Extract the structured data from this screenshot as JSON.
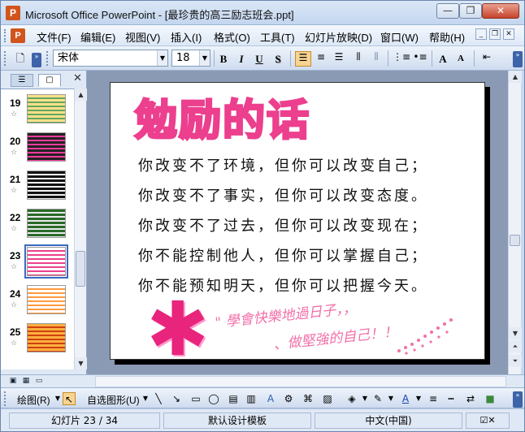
{
  "window": {
    "title": "Microsoft Office PowerPoint - [最珍贵的高三励志班会.ppt]",
    "app_icon_letter": "P",
    "minimize": "—",
    "restore": "❐",
    "close": "✕"
  },
  "menubar": {
    "items": [
      "文件(F)",
      "编辑(E)",
      "视图(V)",
      "插入(I)",
      "格式(O)",
      "工具(T)",
      "幻灯片放映(D)",
      "窗口(W)",
      "帮助(H)"
    ],
    "mdi_minimize": "_",
    "mdi_restore": "❐",
    "mdi_close": "✕"
  },
  "toolbar": {
    "font_name": "宋体",
    "font_size": "18",
    "bold": "B",
    "italic": "I",
    "underline": "U",
    "shadow": "S",
    "increase_font": "A",
    "decrease_font": "A"
  },
  "slides_panel": {
    "thumbnails": [
      {
        "number": "19",
        "colors": [
          "#fde08a",
          "#60a860"
        ]
      },
      {
        "number": "20",
        "colors": [
          "#222222",
          "#ff3aa0"
        ]
      },
      {
        "number": "21",
        "colors": [
          "#111111",
          "#f0f0f0"
        ]
      },
      {
        "number": "22",
        "colors": [
          "#2a6a2a",
          "#eaeaea"
        ]
      },
      {
        "number": "23",
        "colors": [
          "#ffffff",
          "#ec3f8e"
        ],
        "selected": true
      },
      {
        "number": "24",
        "colors": [
          "#ffffff",
          "#ff9a3c"
        ]
      },
      {
        "number": "25",
        "colors": [
          "#fbb040",
          "#d04010"
        ]
      }
    ],
    "star_glyph": "☆",
    "close_glyph": "✕"
  },
  "slide": {
    "title": "勉励的话",
    "lines": [
      "你改变不了环境，但你可以改变自己；",
      "你改变不了事实，但你可以改变态度。",
      "你改变不了过去，但你可以改变现在；",
      "你不能控制他人，但你可以掌握自己；",
      "你不能预知明天，但你可以把握今天。"
    ],
    "asterisk": "✱",
    "handwriting_1": "\" 學會快樂地過日子，，",
    "handwriting_2": "、做堅強的自己！！"
  },
  "drawbar": {
    "draw_label": "绘图(R)",
    "autoshapes_label": "自选图形(U)"
  },
  "statusbar": {
    "slide_info": "幻灯片 23 / 34",
    "design": "默认设计模板",
    "language": "中文(中国)"
  },
  "colors": {
    "accent_pink": "#ec3f8e",
    "slide_bg_area": "#8a9ab4"
  }
}
